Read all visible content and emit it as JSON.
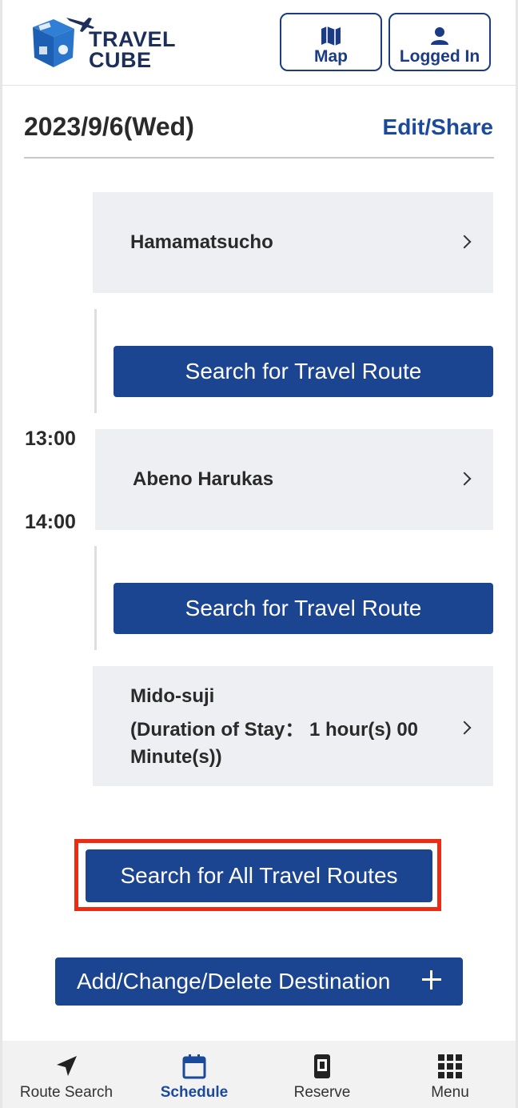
{
  "header": {
    "logo_line1": "TRAVEL",
    "logo_line2": "CUBE",
    "map_label": "Map",
    "login_label": "Logged In"
  },
  "schedule": {
    "date": "2023/9/6(Wed)",
    "edit_label": "Edit/Share",
    "destinations": [
      {
        "name": "Hamamatsucho"
      },
      {
        "name": "Abeno Harukas",
        "time_start": "13:00",
        "time_end": "14:00"
      },
      {
        "name": "Mido-suji",
        "stay_line1": "(Duration of Stay： 1 hour(s) 00",
        "stay_line2": "Minute(s))"
      }
    ],
    "route_button_label": "Search for Travel Route",
    "all_routes_label": "Search for All Travel Routes",
    "add_change_label": "Add/Change/Delete Destination"
  },
  "bottom_nav": [
    {
      "label": "Route Search",
      "icon": "navigation-arrow-icon"
    },
    {
      "label": "Schedule",
      "icon": "calendar-icon",
      "active": true
    },
    {
      "label": "Reserve",
      "icon": "phone-icon"
    },
    {
      "label": "Menu",
      "icon": "grid-icon"
    }
  ],
  "colors": {
    "primary": "#1b4491",
    "highlight": "#ef2a12",
    "card_bg": "#eeeff2"
  }
}
